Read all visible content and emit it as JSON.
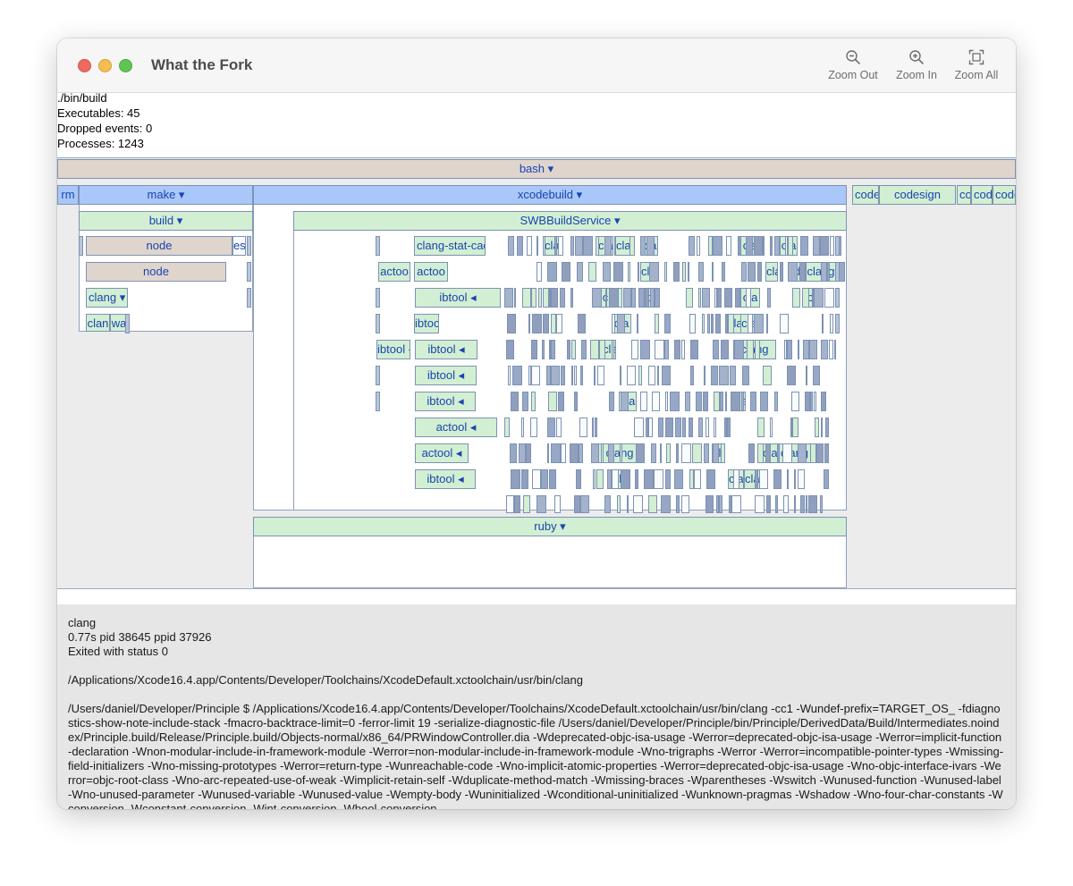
{
  "app": {
    "title": "What the Fork"
  },
  "toolbar": {
    "zoom_out": "Zoom Out",
    "zoom_in": "Zoom In",
    "zoom_all": "Zoom All"
  },
  "summary": {
    "command": "./bin/build",
    "executables": "Executables: 45",
    "dropped": "Dropped events: 0",
    "processes": "Processes: 1243"
  },
  "flame": {
    "labels": {
      "bash": "bash ▾",
      "rm": "rm",
      "make": "make ▾",
      "xcodebuild": "xcodebuild ▾",
      "code1": "code",
      "codesign": "codesign",
      "co": "co",
      "code2": "code",
      "code3": "code",
      "build": "build ▾",
      "swb": "SWBBuildService ▾",
      "node1": "node",
      "es": "es",
      "node2": "node",
      "clang_menu": "clang ▾",
      "clan": "clan",
      "wa": "wa",
      "clang_stat": "clang-stat-cache",
      "actool_a": "actoo",
      "actool_b": "actoo",
      "ibtool_1": "ibtool ◂",
      "ibtoc": "ibtoc",
      "ibtool_left": "ibtool ◂",
      "ibtool_2": "ibtool ◂",
      "ibtool_3": "ibtool ◂",
      "ibtool_4": "ibtool ◂",
      "actool_1": "actool ◂",
      "actool_2": "actool ◂",
      "ibtool_5": "ibtool ◂",
      "cla": "cla",
      "clang": "clang",
      "clan2": "clan",
      "ld": "ld",
      "ds": "ds",
      "ruby": "ruby ▾"
    }
  },
  "details": {
    "name": "clang",
    "timing": "0.77s pid 38645 ppid 37926",
    "status": "Exited with status 0",
    "path": "/Applications/Xcode16.4.app/Contents/Developer/Toolchains/XcodeDefault.xctoolchain/usr/bin/clang",
    "command": "/Users/daniel/Developer/Principle $  /Applications/Xcode16.4.app/Contents/Developer/Toolchains/XcodeDefault.xctoolchain/usr/bin/clang -cc1 -Wundef-prefix=TARGET_OS_ -fdiagnostics-show-note-include-stack -fmacro-backtrace-limit=0 -ferror-limit 19 -serialize-diagnostic-file /Users/daniel/Developer/Principle/bin/Principle/DerivedData/Build/Intermediates.noindex/Principle.build/Release/Principle.build/Objects-normal/x86_64/PRWindowController.dia -Wdeprecated-objc-isa-usage -Werror=deprecated-objc-isa-usage -Werror=implicit-function-declaration -Wnon-modular-include-in-framework-module -Werror=non-modular-include-in-framework-module -Wno-trigraphs -Werror -Werror=incompatible-pointer-types -Wmissing-field-initializers -Wno-missing-prototypes -Werror=return-type -Wunreachable-code -Wno-implicit-atomic-properties -Werror=deprecated-objc-isa-usage -Wno-objc-interface-ivars -Werror=objc-root-class -Wno-arc-repeated-use-of-weak -Wimplicit-retain-self -Wduplicate-method-match -Wmissing-braces -Wparentheses -Wswitch -Wunused-function -Wunused-label -Wno-unused-parameter -Wunused-variable -Wunused-value -Wempty-body -Wuninitialized -Wconditional-uninitialized -Wunknown-pragmas -Wshadow -Wno-four-char-constants -Wconversion -Wconstant-conversion -Wint-conversion -Wbool-conversion"
  },
  "colors": {
    "accent_text": "#1a45b0",
    "tan": "#dfd5cd",
    "blue": "#a9c7f8",
    "green": "#d2efd3",
    "grey": "#b9c5d8"
  }
}
